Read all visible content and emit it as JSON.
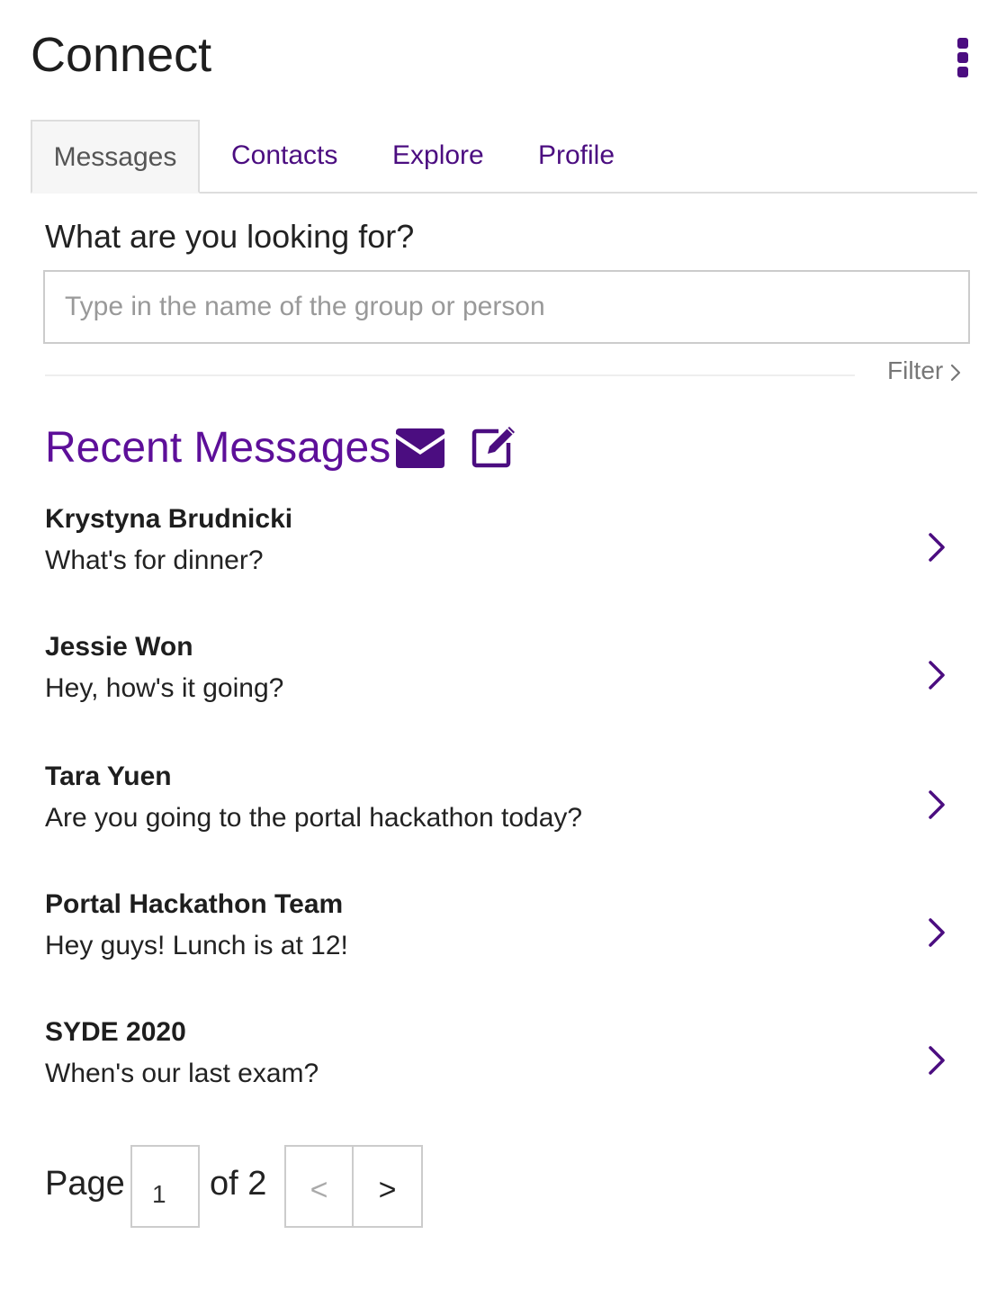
{
  "header": {
    "title": "Connect",
    "menu_icon": "kebab-menu-icon"
  },
  "tabs": [
    {
      "label": "Messages",
      "active": true
    },
    {
      "label": "Contacts",
      "active": false
    },
    {
      "label": "Explore",
      "active": false
    },
    {
      "label": "Profile",
      "active": false
    }
  ],
  "search": {
    "label": "What are you looking for?",
    "value": "",
    "placeholder": "Type in the name of the group or person"
  },
  "filter": {
    "label": "Filter",
    "icon": "chevron-right-icon"
  },
  "recent": {
    "title": "Recent Messages",
    "icons": [
      "envelope-icon",
      "compose-icon"
    ]
  },
  "messages": [
    {
      "name": "Krystyna Brudnicki",
      "preview": "What's for dinner?"
    },
    {
      "name": "Jessie Won",
      "preview": "Hey, how's it going?"
    },
    {
      "name": "Tara Yuen",
      "preview": "Are you going to the portal hackathon today?"
    },
    {
      "name": "Portal Hackathon Team",
      "preview": "Hey guys! Lunch is at 12!"
    },
    {
      "name": "SYDE 2020",
      "preview": "When's our last exam?"
    }
  ],
  "pagination": {
    "page_label": "Page",
    "current_page": "1",
    "of_label": "of 2",
    "prev_label": "<",
    "next_label": ">"
  },
  "colors": {
    "accent": "#4b0d80",
    "heading_accent": "#5d0f99",
    "border": "#cccccc"
  }
}
